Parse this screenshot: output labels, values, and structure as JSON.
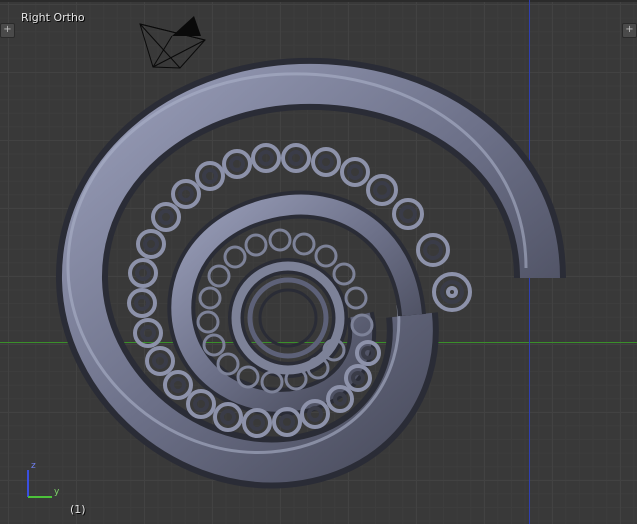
{
  "viewport": {
    "view_name": "Right Ortho",
    "frame": "(1)",
    "corner_left_icon": "plus-icon",
    "corner_right_icon": "plus-icon",
    "corner_glyph": "+"
  },
  "gizmo": {
    "z_label": "z",
    "y_label": "y"
  },
  "colors": {
    "background": "#393939",
    "grid": "#424242",
    "x_axis": "#3a8f2a",
    "z_axis": "#2f3fb0",
    "mesh_light": "#8a8fa8",
    "mesh_dark": "#2a2c36"
  }
}
